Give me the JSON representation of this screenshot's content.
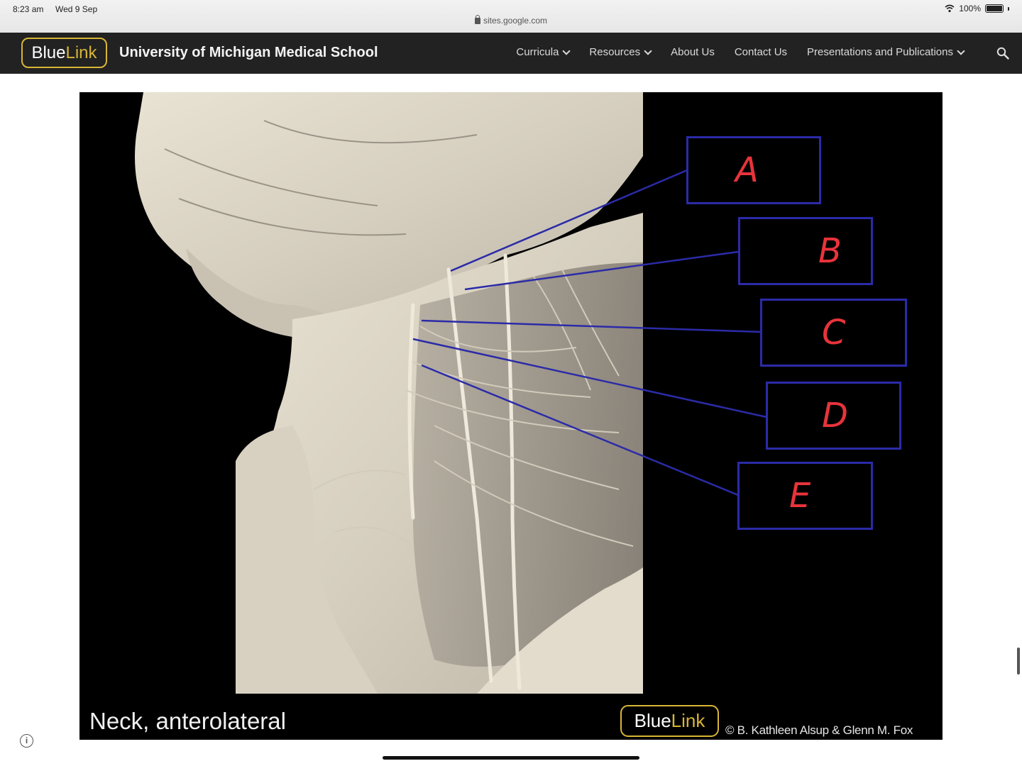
{
  "status": {
    "time": "8:23 am",
    "date": "Wed 9 Sep",
    "battery": "100%",
    "url": "sites.google.com"
  },
  "nav": {
    "logo_blue": "Blue",
    "logo_link": "Link",
    "site_title": "University of Michigan Medical School",
    "items": [
      {
        "label": "Curricula"
      },
      {
        "label": "Resources"
      },
      {
        "label": "About Us"
      },
      {
        "label": "Contact Us"
      },
      {
        "label": "Presentations and Publications"
      }
    ]
  },
  "figure": {
    "caption": "Neck, anterolateral",
    "logo_blue": "Blue",
    "logo_link": "Link",
    "credit": "© B. Kathleen Alsup & Glenn M. Fox",
    "labels": [
      "A",
      "B",
      "C",
      "D",
      "E"
    ],
    "colors": {
      "box": "#2b2ba8",
      "leader": "#2b2ba8",
      "letter": "#e8333b"
    }
  }
}
